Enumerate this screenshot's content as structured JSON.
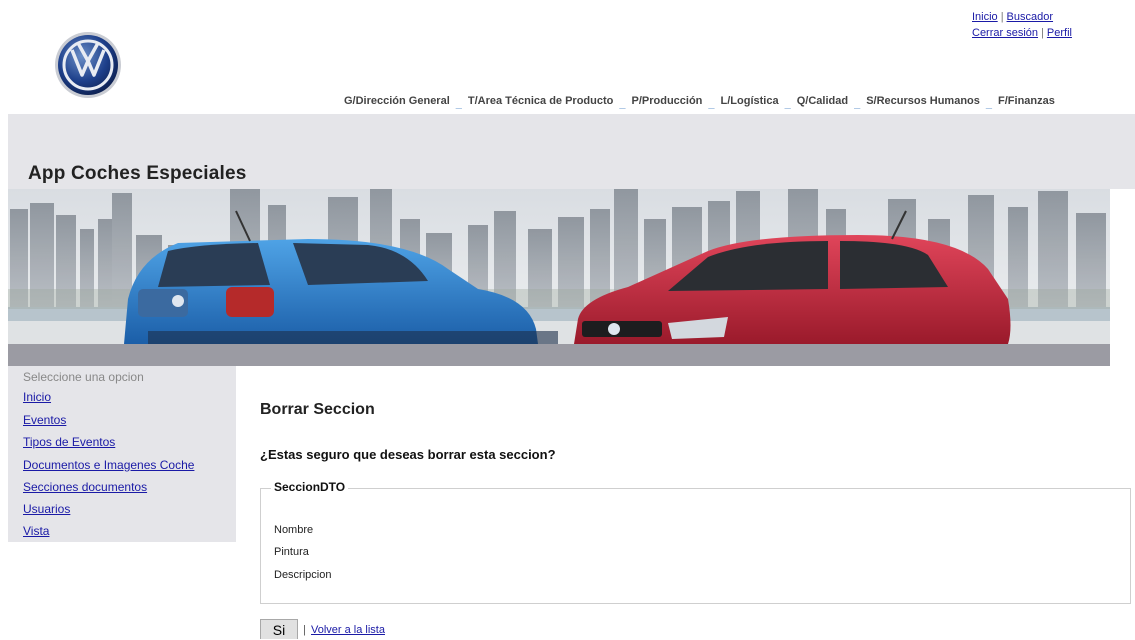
{
  "header": {
    "logo_icon": "vw-logo-icon",
    "top_links": {
      "inicio": "Inicio",
      "buscador": "Buscador",
      "cerrar_sesion": "Cerrar sesión",
      "perfil": "Perfil",
      "separator": "|"
    },
    "departments": [
      "G/Dirección General",
      "T/Area Técnica de Producto",
      "P/Producción",
      "L/Logística",
      "Q/Calidad",
      "S/Recursos Humanos",
      "F/Finanzas"
    ],
    "app_title": "App Coches Especiales"
  },
  "colors": {
    "band": "#e5e5e9",
    "strip": "#9b9ba3",
    "link": "#1a1aa6",
    "blue_car": "#2f7fc8",
    "red_car": "#c0283a"
  },
  "sidebar": {
    "hint": "Seleccione una opcion",
    "items": [
      "Inicio",
      "Eventos",
      "Tipos de Eventos",
      "Documentos e Imagenes Coche",
      "Secciones documentos",
      "Usuarios",
      "Vista"
    ]
  },
  "main": {
    "title": "Borrar Seccion",
    "question": "¿Estas seguro que deseas borrar esta seccion?",
    "fieldset_legend": "SeccionDTO",
    "fields": [
      "Nombre",
      "Pintura",
      "Descripcion"
    ],
    "confirm_button": "Si",
    "separator": "|",
    "back_link": "Volver a la lista"
  }
}
